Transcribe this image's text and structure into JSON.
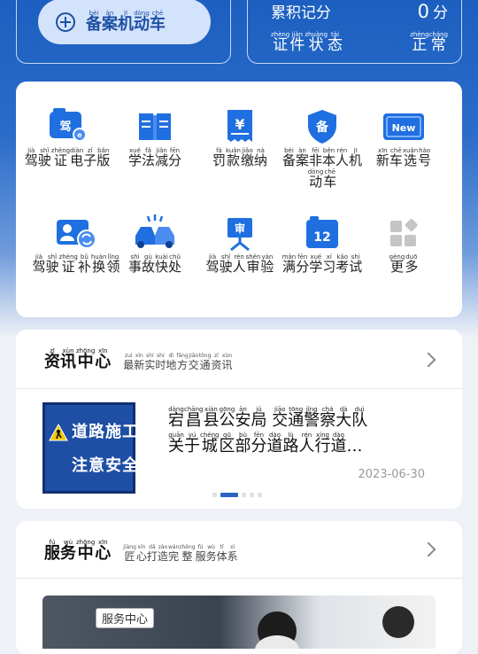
{
  "register": {
    "label": [
      {
        "p": "bèi",
        "c": "备"
      },
      {
        "p": "àn",
        "c": "案"
      },
      {
        "p": "jī",
        "c": "机"
      },
      {
        "p": "dòng",
        "c": "动"
      },
      {
        "p": "chē",
        "c": "车"
      }
    ]
  },
  "stats": {
    "points_label": [
      {
        "p": "",
        "c": "累"
      },
      {
        "p": "",
        "c": "积"
      },
      {
        "p": "",
        "c": "记"
      },
      {
        "p": "",
        "c": "分"
      }
    ],
    "points_value": "0",
    "points_unit": [
      {
        "p": "",
        "c": "分"
      }
    ],
    "status_label": [
      {
        "p": "zhèng",
        "c": "证"
      },
      {
        "p": "jiàn",
        "c": "件"
      },
      {
        "p": "zhuàng",
        "c": "状"
      },
      {
        "p": "tài",
        "c": "态"
      }
    ],
    "status_value": [
      {
        "p": "zhèng",
        "c": "正"
      },
      {
        "p": "cháng",
        "c": "常"
      }
    ]
  },
  "grid": {
    "items": [
      {
        "icon": "e-license-icon",
        "label": [
          {
            "p": "jià",
            "c": "驾"
          },
          {
            "p": "shǐ",
            "c": "驶"
          },
          {
            "p": "zhèng",
            "c": "证"
          },
          {
            "p": "diàn",
            "c": "电"
          },
          {
            "p": "zǐ",
            "c": "子"
          },
          {
            "p": "bǎn",
            "c": "版"
          }
        ]
      },
      {
        "icon": "book-icon",
        "label": [
          {
            "p": "xué",
            "c": "学"
          },
          {
            "p": "fǎ",
            "c": "法"
          },
          {
            "p": "jiǎn",
            "c": "减"
          },
          {
            "p": "fēn",
            "c": "分"
          }
        ]
      },
      {
        "icon": "fine-receipt-icon",
        "label": [
          {
            "p": "fá",
            "c": "罚"
          },
          {
            "p": "kuǎn",
            "c": "款"
          },
          {
            "p": "jiǎo",
            "c": "缴"
          },
          {
            "p": "nà",
            "c": "纳"
          }
        ]
      },
      {
        "icon": "register-shield-icon",
        "badge": "备",
        "label": [
          {
            "p": "bèi",
            "c": "备"
          },
          {
            "p": "àn",
            "c": "案"
          },
          {
            "p": "fēi",
            "c": "非"
          },
          {
            "p": "běn",
            "c": "本"
          },
          {
            "p": "rén",
            "c": "人"
          },
          {
            "p": "jī",
            "c": "机"
          },
          {
            "p": "dòng",
            "c": "动"
          },
          {
            "p": "chē",
            "c": "车"
          }
        ]
      },
      {
        "icon": "new-plate-icon",
        "badge": "New",
        "label": [
          {
            "p": "xīn",
            "c": "新"
          },
          {
            "p": "chē",
            "c": "车"
          },
          {
            "p": "xuǎn",
            "c": "选"
          },
          {
            "p": "hào",
            "c": "号"
          }
        ]
      },
      {
        "icon": "license-renew-icon",
        "label": [
          {
            "p": "jià",
            "c": "驾"
          },
          {
            "p": "shǐ",
            "c": "驶"
          },
          {
            "p": "zhèng",
            "c": "证"
          },
          {
            "p": "bǔ",
            "c": "补"
          },
          {
            "p": "huàn",
            "c": "换"
          },
          {
            "p": "lǐng",
            "c": "领"
          }
        ]
      },
      {
        "icon": "accident-icon",
        "label": [
          {
            "p": "shì",
            "c": "事"
          },
          {
            "p": "gù",
            "c": "故"
          },
          {
            "p": "kuài",
            "c": "快"
          },
          {
            "p": "chǔ",
            "c": "处"
          }
        ]
      },
      {
        "icon": "driver-review-icon",
        "badge": "审",
        "label": [
          {
            "p": "jià",
            "c": "驾"
          },
          {
            "p": "shǐ",
            "c": "驶"
          },
          {
            "p": "rén",
            "c": "人"
          },
          {
            "p": "shěn",
            "c": "审"
          },
          {
            "p": "yàn",
            "c": "验"
          }
        ]
      },
      {
        "icon": "calendar-12-icon",
        "badge": "12",
        "label": [
          {
            "p": "mǎn",
            "c": "满"
          },
          {
            "p": "fēn",
            "c": "分"
          },
          {
            "p": "xué",
            "c": "学"
          },
          {
            "p": "xí",
            "c": "习"
          },
          {
            "p": "kǎo",
            "c": "考"
          },
          {
            "p": "shì",
            "c": "试"
          }
        ]
      },
      {
        "icon": "more-grid-icon",
        "label": [
          {
            "p": "gèng",
            "c": "更"
          },
          {
            "p": "duō",
            "c": "多"
          }
        ]
      }
    ]
  },
  "news": {
    "title": [
      {
        "p": "zī",
        "c": "资"
      },
      {
        "p": "xùn",
        "c": "讯"
      },
      {
        "p": "zhōng",
        "c": "中"
      },
      {
        "p": "xīn",
        "c": "心"
      }
    ],
    "subtitle": [
      {
        "p": "zuì",
        "c": "最"
      },
      {
        "p": "xīn",
        "c": "新"
      },
      {
        "p": "shí",
        "c": "实"
      },
      {
        "p": "shí",
        "c": "时"
      },
      {
        "p": "dì",
        "c": "地"
      },
      {
        "p": "fāng",
        "c": "方"
      },
      {
        "p": "jiāo",
        "c": "交"
      },
      {
        "p": "tōng",
        "c": "通"
      },
      {
        "p": "zī",
        "c": "资"
      },
      {
        "p": "xùn",
        "c": "讯"
      }
    ],
    "image_text_1": "道路施工",
    "image_text_2": "注意安全",
    "headline_line1": [
      {
        "p": "dàng",
        "c": "宕"
      },
      {
        "p": "chāng",
        "c": "昌"
      },
      {
        "p": "xiàn",
        "c": "县"
      },
      {
        "p": "gōng",
        "c": "公"
      },
      {
        "p": "ān",
        "c": "安"
      },
      {
        "p": "jú",
        "c": "局"
      },
      {
        "p": "",
        "c": " "
      },
      {
        "p": "jiāo",
        "c": "交"
      },
      {
        "p": "tōng",
        "c": "通"
      },
      {
        "p": "jǐng",
        "c": "警"
      },
      {
        "p": "chá",
        "c": "察"
      },
      {
        "p": "dà",
        "c": "大"
      },
      {
        "p": "duì",
        "c": "队"
      }
    ],
    "headline_line2": [
      {
        "p": "guān",
        "c": "关"
      },
      {
        "p": "yú",
        "c": "于"
      },
      {
        "p": "chéng",
        "c": "城"
      },
      {
        "p": "qū",
        "c": "区"
      },
      {
        "p": "bù",
        "c": "部"
      },
      {
        "p": "fēn",
        "c": "分"
      },
      {
        "p": "dào",
        "c": "道"
      },
      {
        "p": "lù",
        "c": "路"
      },
      {
        "p": "rén",
        "c": "人"
      },
      {
        "p": "xíng",
        "c": "行"
      },
      {
        "p": "dào",
        "c": "道"
      },
      {
        "p": "",
        "c": "…"
      }
    ],
    "date": "2023-06-30",
    "page_index": 2,
    "page_count": 6
  },
  "service": {
    "title": [
      {
        "p": "fú",
        "c": "服"
      },
      {
        "p": "wù",
        "c": "务"
      },
      {
        "p": "zhōng",
        "c": "中"
      },
      {
        "p": "xīn",
        "c": "心"
      }
    ],
    "subtitle": [
      {
        "p": "jiàng",
        "c": "匠"
      },
      {
        "p": "xīn",
        "c": "心"
      },
      {
        "p": "dǎ",
        "c": "打"
      },
      {
        "p": "zào",
        "c": "造"
      },
      {
        "p": "wán",
        "c": "完"
      },
      {
        "p": "zhěng",
        "c": "整"
      },
      {
        "p": "fú",
        "c": "服"
      },
      {
        "p": "wù",
        "c": "务"
      },
      {
        "p": "tǐ",
        "c": "体"
      },
      {
        "p": "xì",
        "c": "系"
      }
    ],
    "badge": "服务中心"
  },
  "colors": {
    "brand_blue": "#1c5fc0",
    "accent_blue": "#2a63c2"
  }
}
